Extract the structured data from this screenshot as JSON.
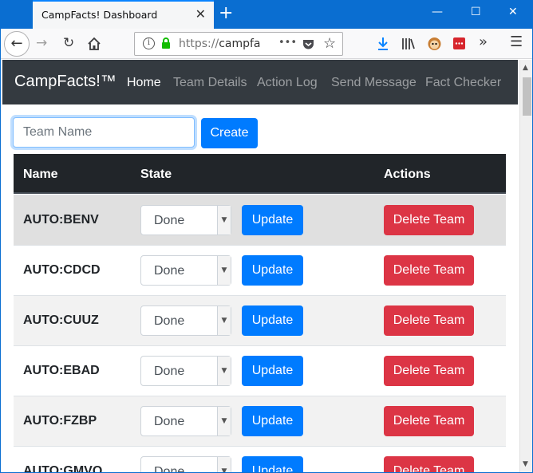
{
  "browser": {
    "tab_title": "CampFacts! Dashboard",
    "tab_close": "✕",
    "new_tab": "+",
    "win_min": "—",
    "win_max": "☐",
    "win_close": "✕",
    "url_proto": "https://",
    "url_host": "campfa",
    "url_menu": "•••",
    "icons": [
      "back-arrow",
      "forward-arrow",
      "reload",
      "home",
      "info",
      "lock",
      "pocket",
      "bookmark-star",
      "download",
      "library",
      "extension-monkey",
      "extension-red",
      "overflow",
      "hamburger-menu"
    ]
  },
  "app": {
    "brand": "CampFacts!™",
    "nav": [
      {
        "label": "Home",
        "active": true
      },
      {
        "label": "Team Details",
        "active": false
      },
      {
        "label": "Action Log",
        "active": false
      },
      {
        "label": "Send Message",
        "active": false
      },
      {
        "label": "Fact Checker",
        "active": false
      }
    ]
  },
  "form": {
    "placeholder": "Team Name",
    "create_label": "Create"
  },
  "table": {
    "headers": {
      "name": "Name",
      "state": "State",
      "actions": "Actions"
    },
    "rows": [
      {
        "name": "AUTO:BENV",
        "state": "Done",
        "update": "Update",
        "delete": "Delete Team"
      },
      {
        "name": "AUTO:CDCD",
        "state": "Done",
        "update": "Update",
        "delete": "Delete Team"
      },
      {
        "name": "AUTO:CUUZ",
        "state": "Done",
        "update": "Update",
        "delete": "Delete Team"
      },
      {
        "name": "AUTO:EBAD",
        "state": "Done",
        "update": "Update",
        "delete": "Delete Team"
      },
      {
        "name": "AUTO:FZBP",
        "state": "Done",
        "update": "Update",
        "delete": "Delete Team"
      },
      {
        "name": "AUTO:GMVQ",
        "state": "Done",
        "update": "Update",
        "delete": "Delete Team"
      }
    ]
  },
  "colors": {
    "titlebar": "#0a6ed1",
    "navbar": "#343a40",
    "table_head": "#212529",
    "primary": "#007bff",
    "danger": "#dc3545"
  }
}
